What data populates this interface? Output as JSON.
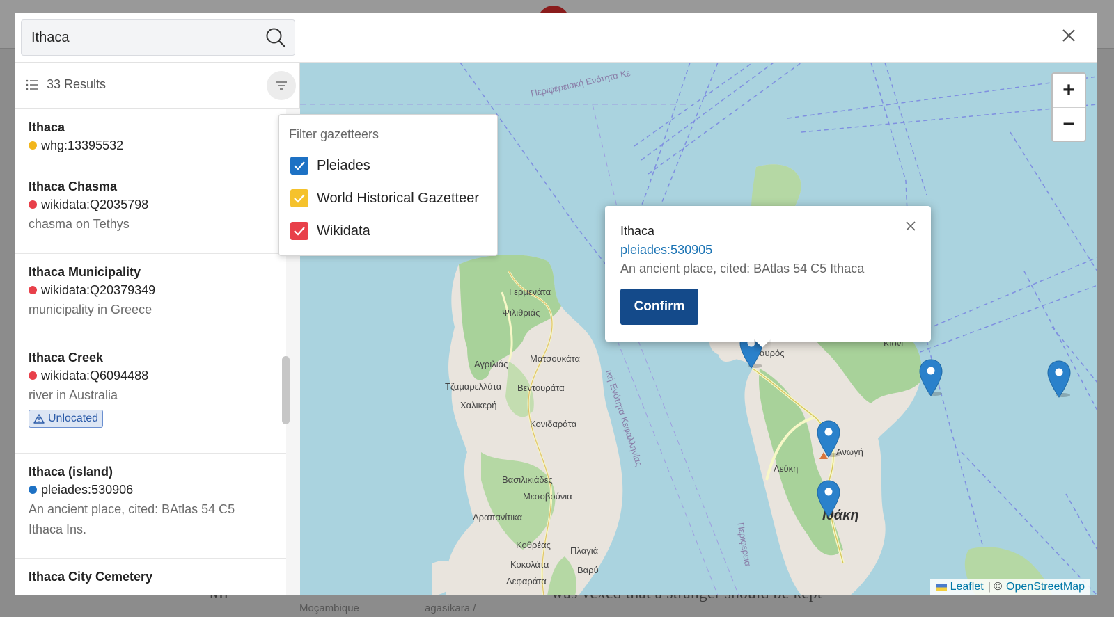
{
  "search": {
    "value": "Ithaca"
  },
  "results": {
    "count_label": "33 Results",
    "items": [
      {
        "title": "Ithaca",
        "id": "whg:13395532",
        "dot": "#f2b61c",
        "desc": ""
      },
      {
        "title": "Ithaca Chasma",
        "id": "wikidata:Q2035798",
        "dot": "#e8404a",
        "desc": "chasma on Tethys"
      },
      {
        "title": "Ithaca Municipality",
        "id": "wikidata:Q20379349",
        "dot": "#e8404a",
        "desc": "municipality in Greece"
      },
      {
        "title": "Ithaca Creek",
        "id": "wikidata:Q6094488",
        "dot": "#e8404a",
        "desc": "river in Australia",
        "badge": "Unlocated"
      },
      {
        "title": "Ithaca (island)",
        "id": "pleiades:530906",
        "dot": "#1d71c4",
        "desc": "An ancient place, cited: BAtlas 54 C5 Ithaca Ins."
      },
      {
        "title": "Ithaca City Cemetery",
        "id": "",
        "dot": "",
        "desc": ""
      }
    ]
  },
  "filter": {
    "title": "Filter gazetteers",
    "options": [
      {
        "label": "Pleiades",
        "checked": true,
        "color": "#1d71c4"
      },
      {
        "label": "World Historical Gazetteer",
        "checked": true,
        "color": "#f5c22c"
      },
      {
        "label": "Wikidata",
        "checked": true,
        "color": "#e8404a"
      }
    ]
  },
  "popup": {
    "title": "Ithaca",
    "link": "pleiades:530905",
    "desc": "An ancient place, cited: BAtlas 54 C5 Ithaca",
    "confirm": "Confirm"
  },
  "map": {
    "zoom_in": "+",
    "zoom_out": "−",
    "attribution": {
      "leaflet": "Leaflet",
      "sep": "| ©",
      "osm": "OpenStreetMap"
    },
    "labels": {
      "region": "Περιφερειακή Ενότητα Κε",
      "l1": "Γερμενάτα",
      "l2": "Ψιλιθριάς",
      "l3": "Ματσουκάτα",
      "l4": "Αγριλιάς",
      "l5": "Τζαμαρελλάτα",
      "l6": "Βεντουράτα",
      "l7": "Χαλικερή",
      "l8": "Κονιδαράτα",
      "l9": "Βασιλικιάδες",
      "l10": "Μεσοβούνια",
      "l11": "Δραπανίτικα",
      "l12": "Κοθρέας",
      "l13": "Πλαγιά",
      "l14": "Κοκολάτα",
      "l15": "Βαρύ",
      "l16": "Δεφαράτα",
      "l17": "αυρός",
      "l18": "Κιόνι",
      "l19": "Ανωγή",
      "l20": "Λεύκη",
      "island": "Ιθάκη",
      "strait": "ική Ενότητα Κεφαλληνίας",
      "east": "Περιφερεια"
    }
  },
  "background": {
    "text1": "Mi",
    "text2": "was vexed that a stranger should be kept",
    "small1": "Moçambique",
    "small2": "agasikara /"
  },
  "colors": {
    "pleiades": "#1d71c4",
    "whg": "#f2b61c",
    "wikidata": "#e8404a",
    "confirm": "#144a8a",
    "marker": "#2a81cb"
  }
}
